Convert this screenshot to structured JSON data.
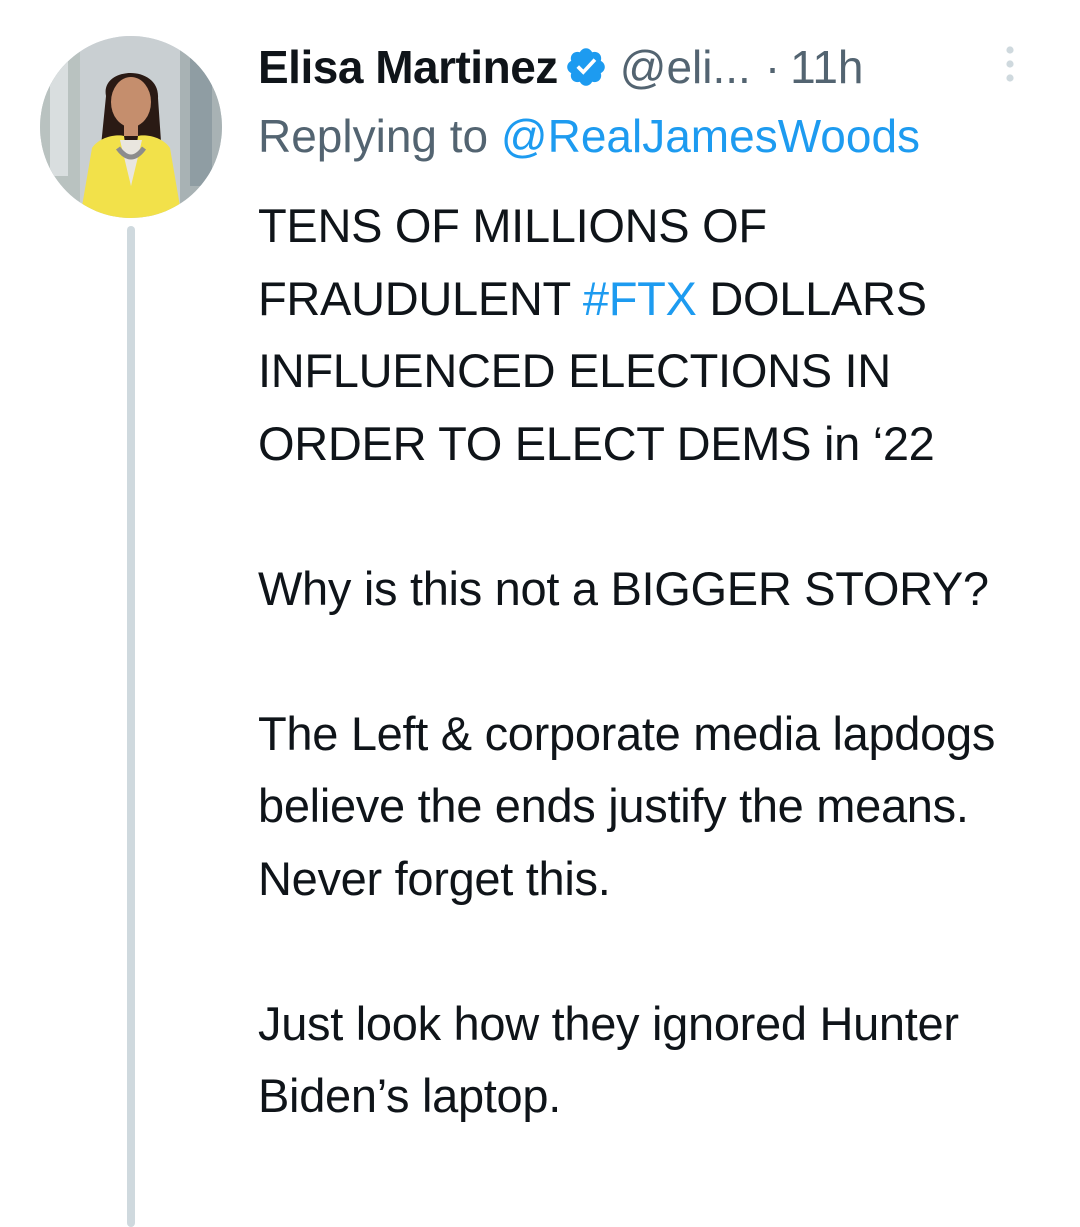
{
  "author": {
    "name": "Elisa Martinez",
    "handle": "@eli...",
    "separator": "·",
    "time": "11h",
    "avatar_icon": "profile-photo",
    "verified_icon": "verified-badge-icon",
    "verified_color": "#1d9bf0"
  },
  "reply": {
    "prefix": "Replying to ",
    "target": "@RealJamesWoods"
  },
  "tweet": {
    "p1_before": "TENS OF MILLIONS OF FRAUDULENT ",
    "p1_hashtag": "#FTX",
    "p1_after": " DOLLARS INFLUENCED ELECTIONS IN ORDER TO ELECT DEMS in ‘22",
    "p2": "Why is this not a BIGGER STORY?",
    "p3": "The Left & corporate media lapdogs believe the ends justify the means. Never forget this.",
    "p4": "Just look how they ignored Hunter Biden’s laptop."
  },
  "colors": {
    "text": "#0f1419",
    "secondary": "#536471",
    "link": "#1d9bf0",
    "thread_line": "#cfd9de"
  },
  "more_icon": "more-vertical-icon"
}
